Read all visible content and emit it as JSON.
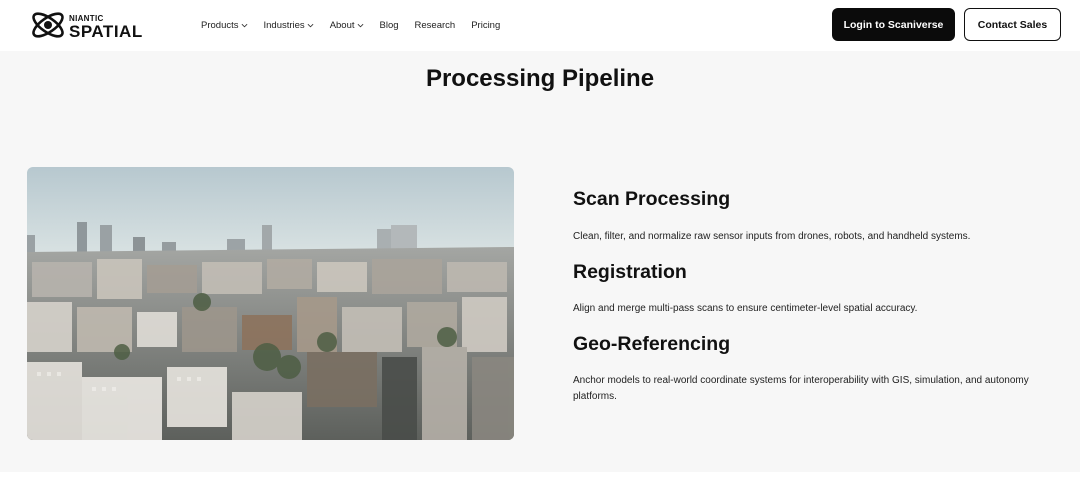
{
  "header": {
    "logo": {
      "small": "NIANTIC",
      "big": "SPATIAL"
    },
    "nav": [
      {
        "label": "Products",
        "has_dropdown": true,
        "icon": "chevron-down-icon"
      },
      {
        "label": "Industries",
        "has_dropdown": true,
        "icon": "chevron-down-icon"
      },
      {
        "label": "About",
        "has_dropdown": true,
        "icon": "chevron-down-icon"
      },
      {
        "label": "Blog",
        "has_dropdown": false
      },
      {
        "label": "Research",
        "has_dropdown": false
      },
      {
        "label": "Pricing",
        "has_dropdown": false
      }
    ],
    "login_label": "Login to Scaniverse",
    "contact_label": "Contact Sales"
  },
  "main": {
    "title": "Processing Pipeline",
    "image_icon": "city-aerial-photo",
    "steps": [
      {
        "title": "Scan Processing",
        "description": "Clean, filter, and normalize raw sensor inputs from drones, robots, and handheld systems."
      },
      {
        "title": "Registration",
        "description": "Align and merge multi-pass scans to ensure centimeter-level spatial accuracy."
      },
      {
        "title": "Geo-Referencing",
        "description": "Anchor models to real-world coordinate systems for interoperability with GIS, simulation, and autonomy platforms."
      }
    ]
  },
  "colors": {
    "button_dark": "#0b0b0b",
    "section_bg": "#f7f7f7",
    "text": "#111111"
  }
}
